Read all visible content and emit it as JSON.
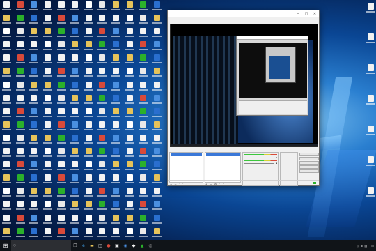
{
  "desktop": {
    "icon_colors": [
      "#f3f3f3",
      "#e9e9e9",
      "#4a8fe0",
      "#e6c35a",
      "#f3f3f3",
      "#2a6fcf",
      "#ffffff",
      "#d84a3a",
      "#e6c35a",
      "#f3f3f3",
      "#2bb02b",
      "#f3f3f3"
    ],
    "right_icons": [
      {
        "label": ""
      },
      {
        "label": ""
      },
      {
        "label": ""
      },
      {
        "label": ""
      },
      {
        "label": ""
      },
      {
        "label": ""
      },
      {
        "label": ""
      }
    ]
  },
  "obs": {
    "title": "",
    "menu": [
      "",
      "",
      "",
      "",
      "",
      "",
      ""
    ],
    "docks": {
      "scenes": {
        "title": "",
        "items": [
          "",
          ""
        ]
      },
      "sources": {
        "title": "",
        "items": [
          ""
        ]
      },
      "mixer": {
        "title": "",
        "channels": [
          {
            "label": ""
          },
          {
            "label": ""
          }
        ]
      },
      "transitions": {
        "title": ""
      },
      "controls": {
        "title": "",
        "buttons": [
          "",
          "",
          "",
          "",
          "",
          ""
        ]
      }
    },
    "status": {
      "live": "",
      "rec": "",
      "cpu": "",
      "fps": ""
    }
  },
  "taskbar": {
    "search_placeholder": "",
    "time": "",
    "date": ""
  }
}
